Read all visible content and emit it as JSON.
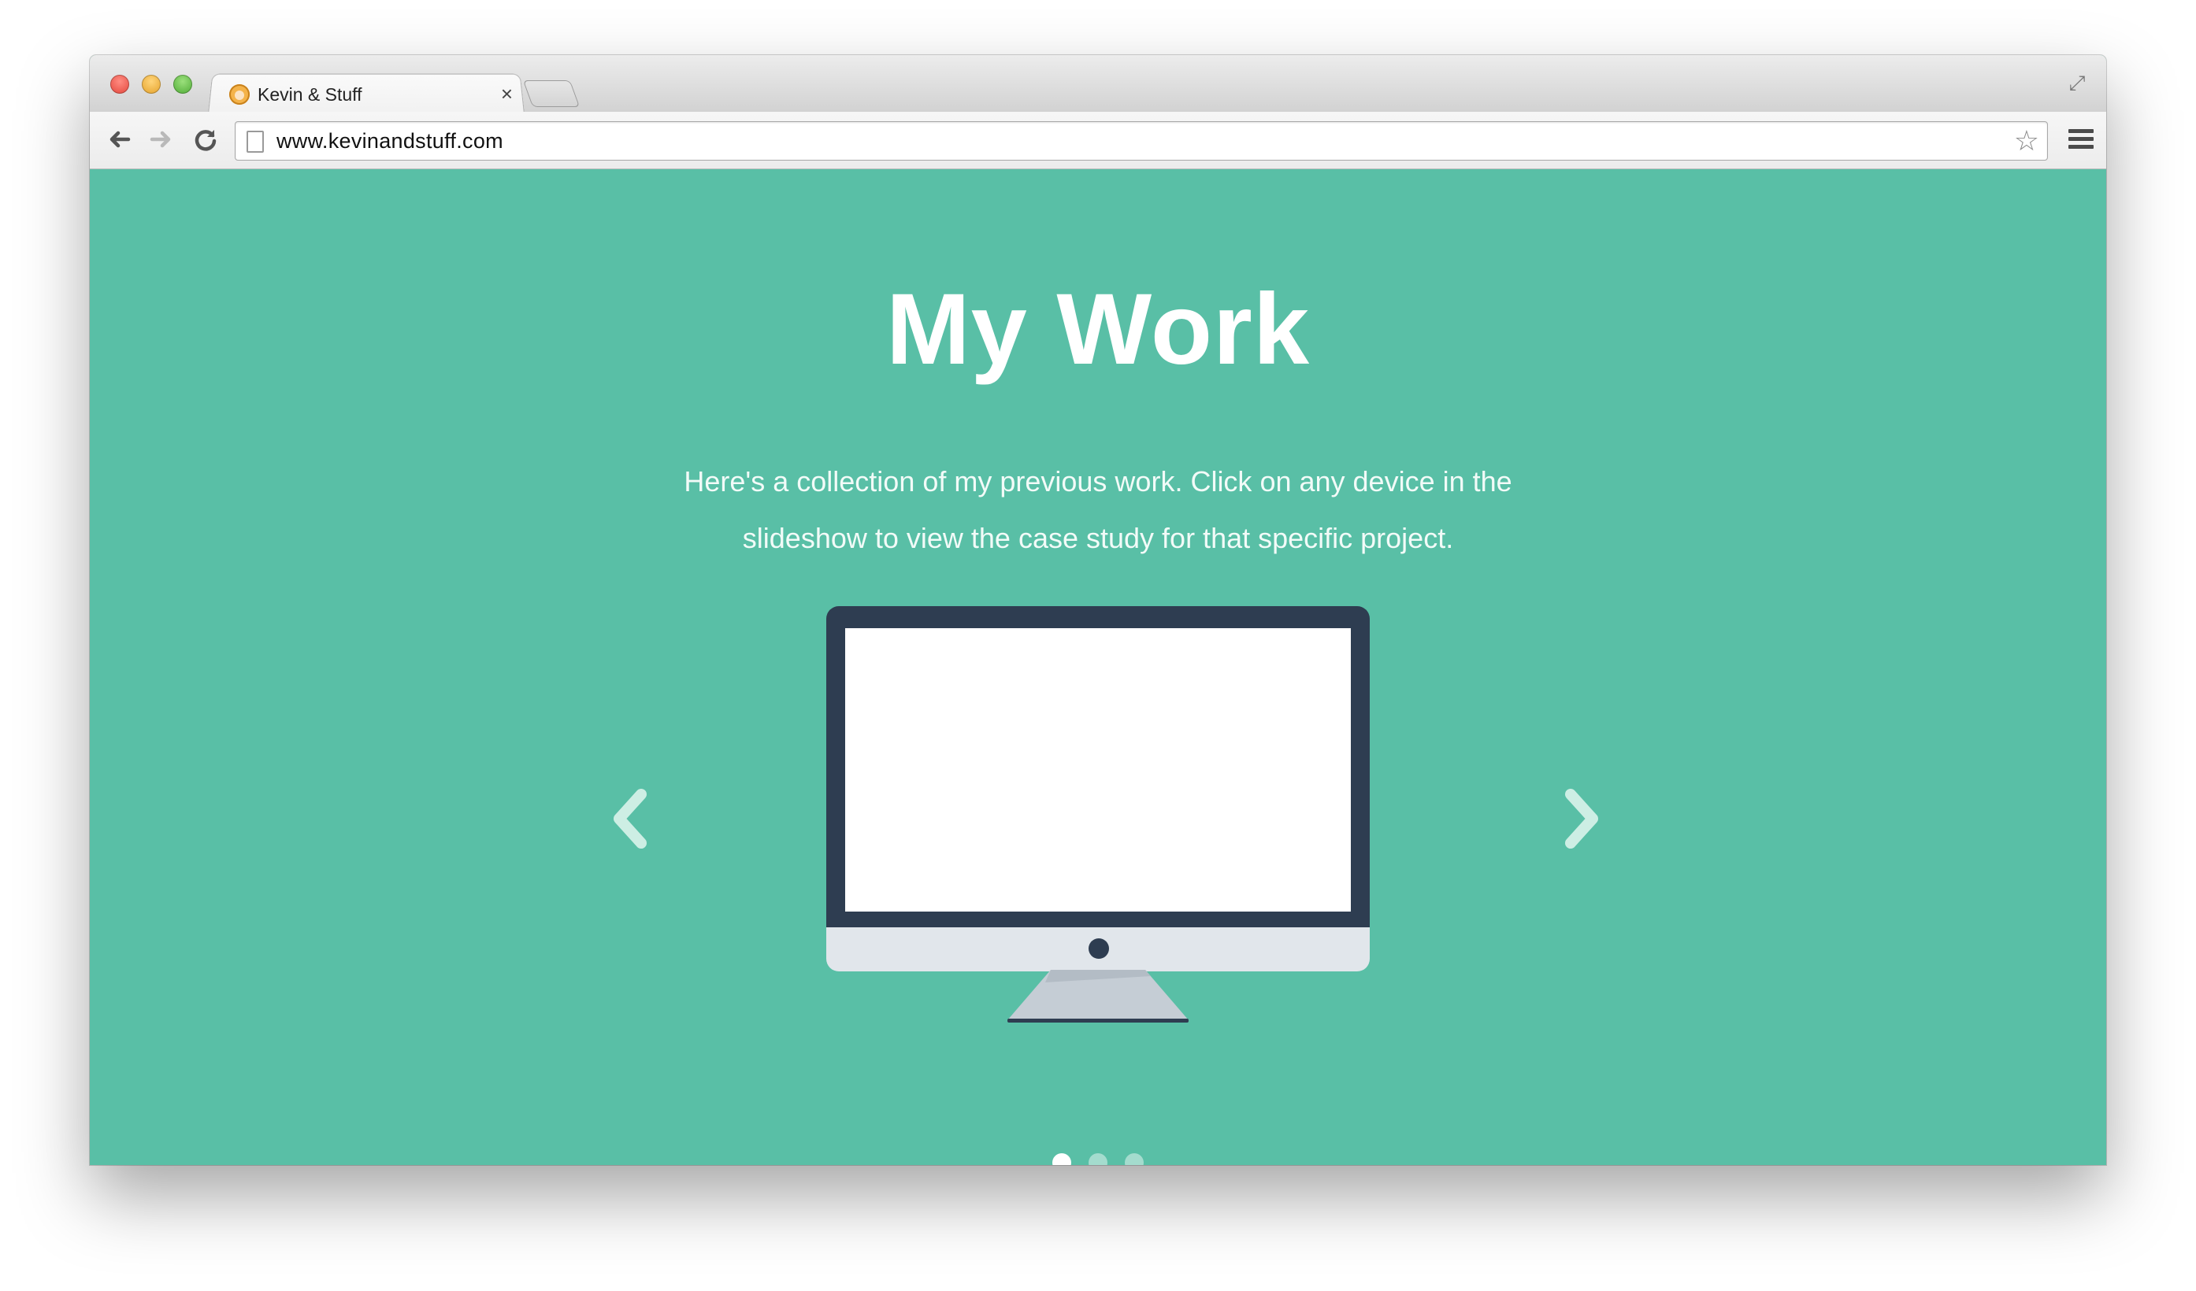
{
  "browser": {
    "tab_title": "Kevin & Stuff",
    "tab_close": "×",
    "url": "www.kevinandstuff.com",
    "star_glyph": "☆",
    "fullscreen_glyph": "⤢"
  },
  "page": {
    "heading": "My Work",
    "description": "Here's a collection of my previous work. Click on any device in the slideshow to view the case study for that specific project."
  },
  "slideshow": {
    "total_slides": 3,
    "active_slide": 1
  },
  "colors": {
    "background": "#59bfa6",
    "monitor_bezel": "#2e3d51",
    "monitor_chin": "#e1e6eb",
    "text": "#ffffff"
  }
}
